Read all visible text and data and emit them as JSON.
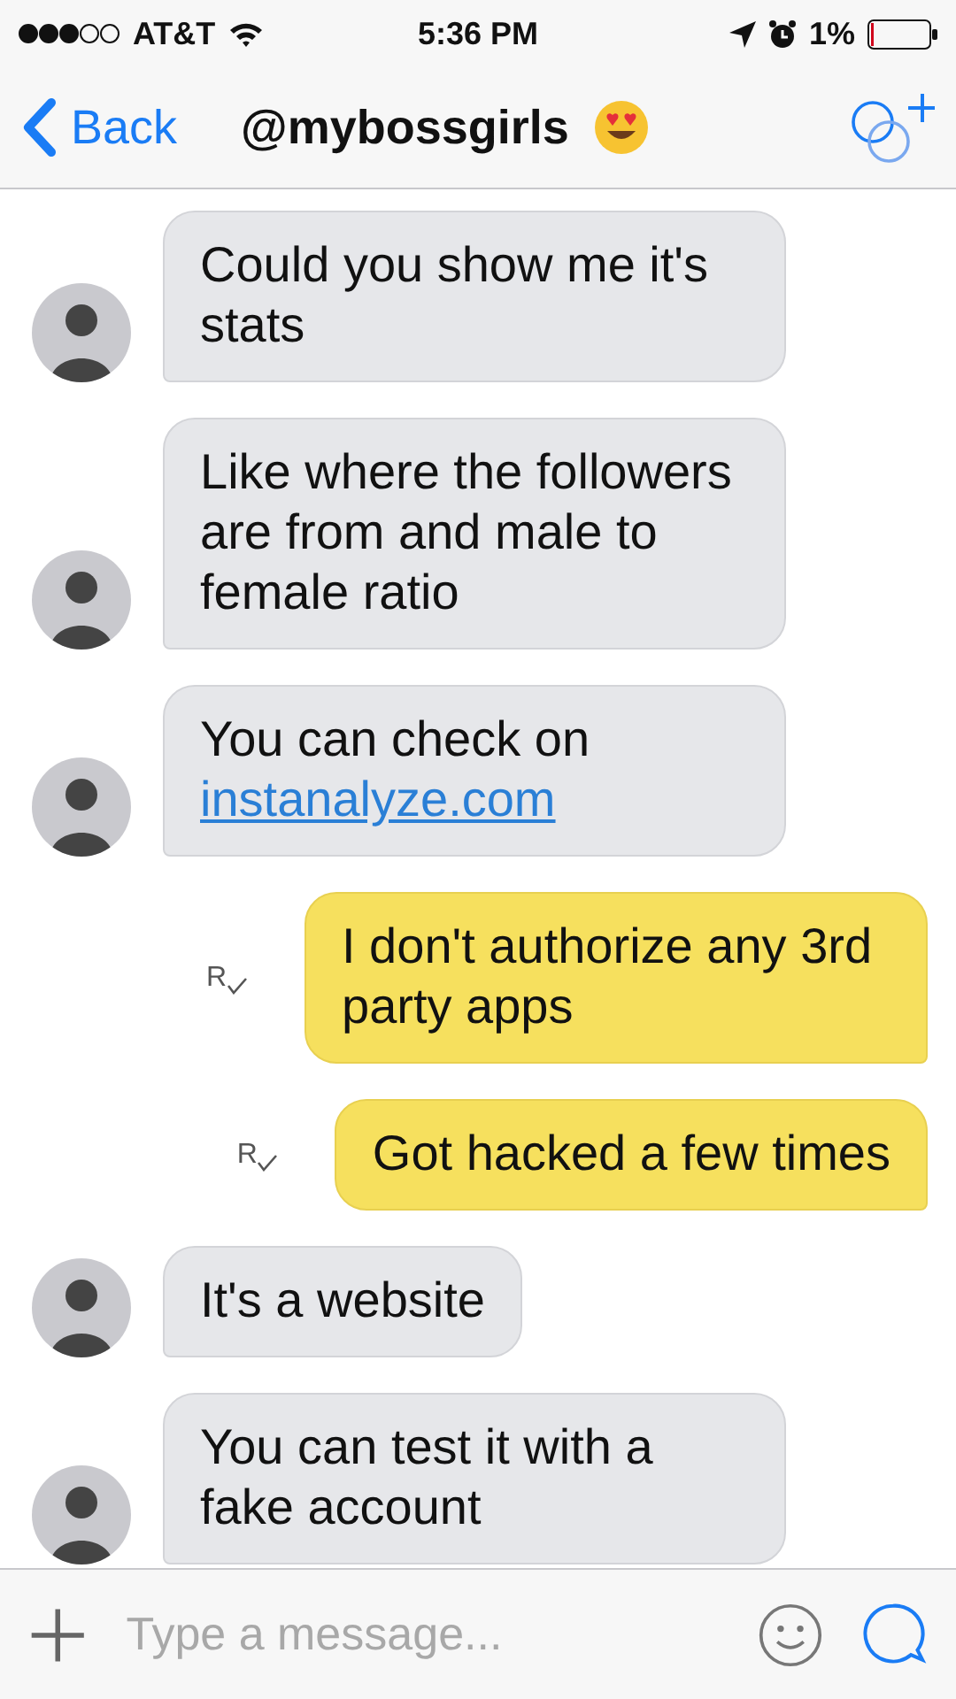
{
  "status_bar": {
    "carrier": "AT&T",
    "time": "5:36 PM",
    "battery": "1%"
  },
  "nav": {
    "back": "Back",
    "title": "@mybossgirls"
  },
  "messages": [
    {
      "kind": "incoming",
      "text": "Could you show me it's stats"
    },
    {
      "kind": "incoming",
      "text": "Like where the followers are from and male to female ratio"
    },
    {
      "kind": "incoming",
      "text": "You can check on",
      "link": "instanalyze.com"
    },
    {
      "kind": "outgoing",
      "text": "I don't authorize any 3rd party apps",
      "receipt": "R"
    },
    {
      "kind": "outgoing",
      "text": "Got hacked a few times",
      "receipt": "R"
    },
    {
      "kind": "incoming",
      "text": "It's a website"
    },
    {
      "kind": "incoming",
      "text": "You can test it with a fake account"
    }
  ],
  "composer": {
    "placeholder": "Type a message..."
  }
}
